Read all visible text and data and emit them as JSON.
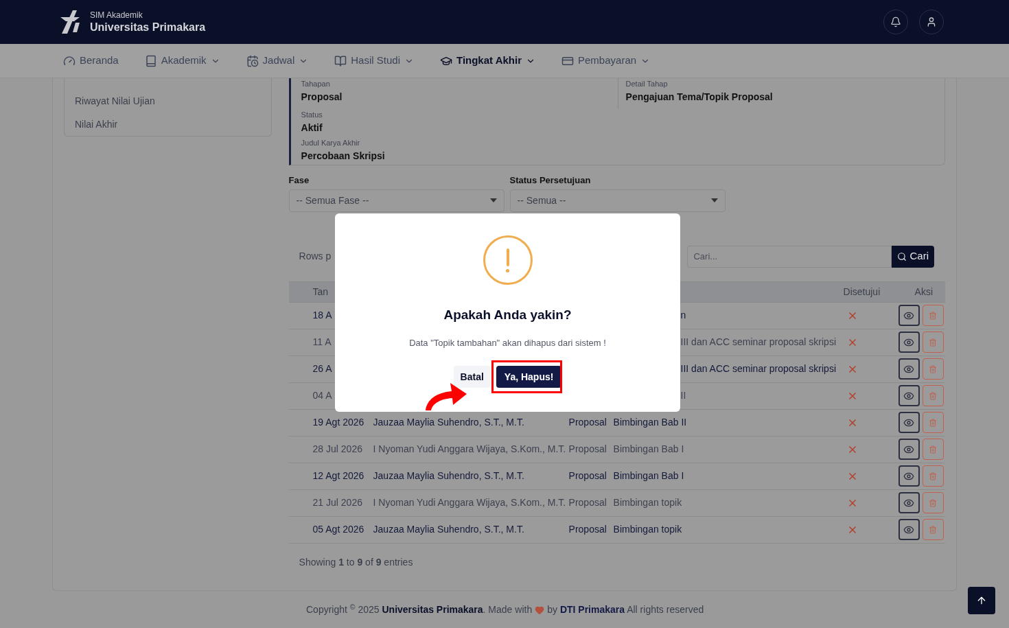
{
  "header": {
    "subtitle": "SIM Akademik",
    "title": "Universitas Primakara"
  },
  "nav": [
    {
      "label": "Beranda",
      "kind": "gauge",
      "dropdown": false,
      "selected": false
    },
    {
      "label": "Akademik",
      "kind": "book",
      "dropdown": true,
      "selected": false
    },
    {
      "label": "Jadwal",
      "kind": "calendar",
      "dropdown": true,
      "selected": false
    },
    {
      "label": "Hasil Studi",
      "kind": "books",
      "dropdown": true,
      "selected": false
    },
    {
      "label": "Tingkat Akhir",
      "kind": "cap",
      "dropdown": true,
      "selected": true
    },
    {
      "label": "Pembayaran",
      "kind": "card",
      "dropdown": true,
      "selected": false
    }
  ],
  "sidebar": {
    "items": [
      "Riwayat Nilai Ujian",
      "Nilai Akhir"
    ]
  },
  "info": {
    "row": [
      {
        "label": "Tahapan",
        "value": "Proposal"
      },
      {
        "label": "Detail Tahap",
        "value": "Pengajuan Tema/Topik Proposal"
      }
    ],
    "fields": [
      {
        "label": "Status",
        "value": "Aktif"
      },
      {
        "label": "Judul Karya Akhir",
        "value": "Percobaan Skripsi"
      }
    ]
  },
  "filters": [
    {
      "label": "Fase",
      "value": "-- Semua Fase --"
    },
    {
      "label": "Status Persetujuan",
      "value": "-- Semua --"
    }
  ],
  "table": {
    "rows_label": "Rows p",
    "search": {
      "placeholder": "Cari...",
      "button": "Cari"
    },
    "columns": [
      "Tan",
      "Disetujui",
      "Aksi"
    ],
    "rows": [
      {
        "kind": "covered",
        "date": "18 A",
        "topic": "n",
        "approved": false,
        "highlighted": true
      },
      {
        "kind": "covered",
        "date": "11 A",
        "topic": "III dan ACC seminar proposal skripsi",
        "approved": false,
        "highlighted": false
      },
      {
        "kind": "covered",
        "date": "26 A",
        "topic": "III dan ACC seminar proposal skripsi",
        "approved": false,
        "highlighted": true
      },
      {
        "kind": "covered",
        "date": "04 A",
        "topic": "II",
        "approved": false,
        "highlighted": false
      },
      {
        "kind": "full",
        "date": "19 Agt 2026",
        "lecturer": "Jauzaa Maylia Suhendro, S.T., M.T.",
        "phase": "Proposal",
        "topic": "Bimbingan Bab II",
        "approved": false,
        "highlighted": true
      },
      {
        "kind": "full",
        "date": "28 Jul 2026",
        "lecturer": "I Nyoman Yudi Anggara Wijaya, S.Kom., M.T.",
        "phase": "Proposal",
        "topic": "Bimbingan Bab I",
        "approved": false,
        "highlighted": false
      },
      {
        "kind": "full",
        "date": "12 Agt 2026",
        "lecturer": "Jauzaa Maylia Suhendro, S.T., M.T.",
        "phase": "Proposal",
        "topic": "Bimbingan Bab I",
        "approved": false,
        "highlighted": true
      },
      {
        "kind": "full",
        "date": "21 Jul 2026",
        "lecturer": "I Nyoman Yudi Anggara Wijaya, S.Kom., M.T.",
        "phase": "Proposal",
        "topic": "Bimbingan topik",
        "approved": false,
        "highlighted": false
      },
      {
        "kind": "full",
        "date": "05 Agt 2026",
        "lecturer": "Jauzaa Maylia Suhendro, S.T., M.T.",
        "phase": "Proposal",
        "topic": "Bimbingan topik",
        "approved": false,
        "highlighted": true
      }
    ],
    "summary": "Showing **1** to **9** of **9** entries"
  },
  "modal": {
    "title": "Apakah Anda yakin?",
    "message": "Data \"Topik tambahan\" akan dihapus dari sistem !",
    "cancel": "Batal",
    "confirm": "Ya, Hapus!"
  },
  "footer": {
    "text": "Copyright $^{©}$ 2025 **Universitas Primakara**. Made with",
    "by": "by",
    "link": "DTI Primakara",
    "rest": "All rights reserved"
  }
}
